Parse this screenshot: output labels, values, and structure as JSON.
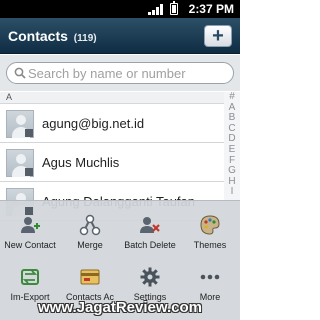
{
  "status_bar": {
    "time": "2:37 PM",
    "icons": [
      "signal-icon",
      "battery-icon"
    ]
  },
  "header": {
    "title": "Contacts",
    "count": "(119)",
    "add_label": "+",
    "color": "#1f4058"
  },
  "search": {
    "placeholder": "Search by name or number"
  },
  "list": {
    "section_header": "A",
    "contacts": [
      {
        "name": "agung@big.net.id"
      },
      {
        "name": "Agus Muchlis"
      },
      {
        "name": "Agung Dalangganti Taufan"
      }
    ]
  },
  "index_letters": [
    "#",
    "A",
    "B",
    "C",
    "D",
    "E",
    "F",
    "G",
    "H",
    "I"
  ],
  "menu": {
    "items": [
      {
        "label": "New Contact",
        "icon": "new-contact-icon"
      },
      {
        "label": "Merge",
        "icon": "merge-icon"
      },
      {
        "label": "Batch Delete",
        "icon": "batch-delete-icon"
      },
      {
        "label": "Themes",
        "icon": "themes-icon"
      },
      {
        "label": "Im-Export",
        "icon": "import-export-icon"
      },
      {
        "label": "Contacts Ac",
        "icon": "contacts-account-icon"
      },
      {
        "label": "Settings",
        "icon": "settings-icon"
      },
      {
        "label": "More",
        "icon": "more-icon"
      }
    ]
  },
  "watermark": "www.JagatReview.com"
}
